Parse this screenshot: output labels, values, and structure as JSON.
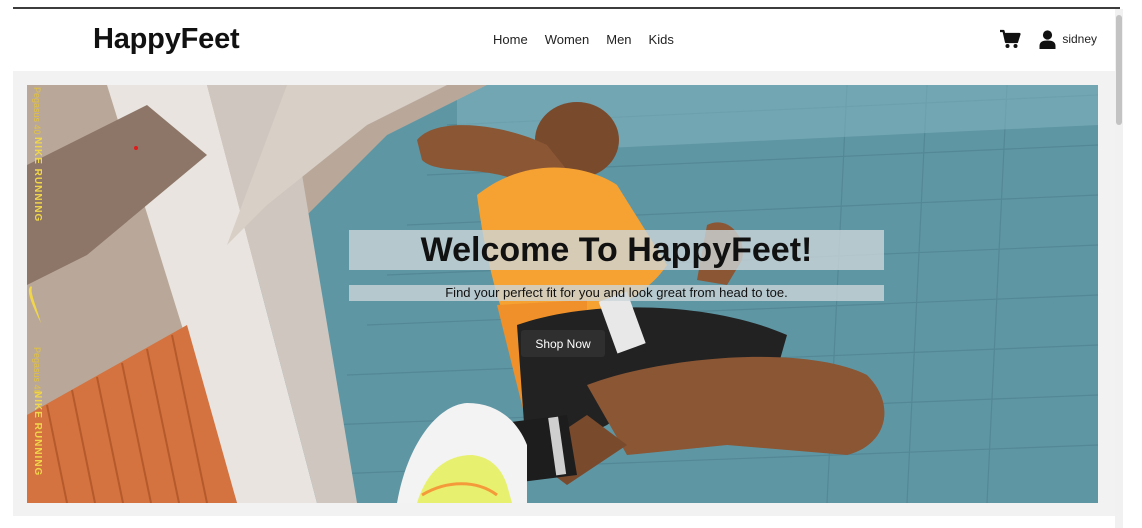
{
  "navbar": {
    "brand": "HappyFeet",
    "links": [
      {
        "label": "Home"
      },
      {
        "label": "Women"
      },
      {
        "label": "Men"
      },
      {
        "label": "Kids"
      }
    ],
    "cart_icon": "cart-icon",
    "user_icon": "user-icon",
    "username": "sidney"
  },
  "hero": {
    "title": "Welcome To HappyFeet!",
    "subtitle": "Find your perfect fit for you and look great from head to toe.",
    "cta_label": "Shop Now",
    "banner_text": "NIKE RUNNING",
    "banner_small_text": "Pegasus 40"
  },
  "colors": {
    "cta_background": "#2f2f2f",
    "banner_text": "#f1d64a",
    "hero_wall": "#5f96a4",
    "runner_shirt": "#f5a233"
  }
}
